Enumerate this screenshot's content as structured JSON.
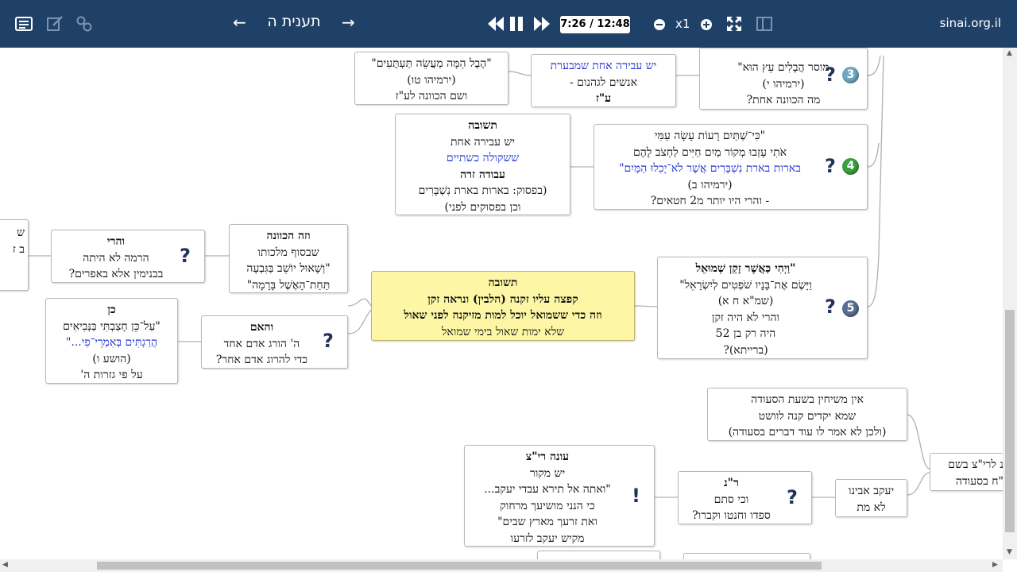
{
  "topbar": {
    "title": "תענית ה",
    "time": "7:26 / 12:48",
    "speed": "x1",
    "site": "sinai.org.il",
    "prev_arrow": "←",
    "next_arrow": "→",
    "icons": [
      "list-icon",
      "edit-icon",
      "link-icon",
      "rewind-icon",
      "pause-icon",
      "fast-forward-icon",
      "zoom-out-icon",
      "zoom-in-icon",
      "fullscreen-icon",
      "split-view-icon"
    ]
  },
  "colors": {
    "topbar": "#1f4168",
    "center_node": "#fdf7a5",
    "blue_text": "#1a2fd0",
    "num3": "#6fa8c2",
    "num4": "#3d9f43",
    "num5": "#5d6e96"
  },
  "mindmap": {
    "n_top_left": [
      "\"הֶבֶל הֵמָּה מַעֲשֵׂה תַּעְתֻּעִים\"",
      "(ירמיהו טו)",
      "ושם הכוונה לע\"ז"
    ],
    "n_top_mid": [
      "יש עבירה אחת  שמבערת",
      "אנשים לגהנום -",
      "ע\"ז"
    ],
    "n_q3": [
      "מוסר הֲבָלִים  עֵץ הוּא\"",
      "(ירמיהו י)",
      "מה הכוונה אחת?"
    ],
    "n_q3_num": "3",
    "n_answer1": [
      "תשובה",
      "יש עבירה אחת",
      "ששקולה כשתיים",
      "עבודה זרה",
      "(בפסוק: בארות בארת נִשְׁבָּרִים",
      "וכן בפסוקים לפני)"
    ],
    "n_q4": [
      "\"כִּי־שְׁתַּיִם רָעוֹת  עָשָׂה עַמִּי",
      "אֹתִי עָזְבוּ מְקוֹר מַיִם חַיִּים לַחְצֹב לָהֶם",
      "בארות בארת נִשְׁבָּרִים  אֲשֶׁר לֹא־יָכִלוּ הַמָּיִם\"",
      "(ירמיהו ב)",
      "- והרי היו יותר מ2 חטאים?"
    ],
    "n_q4_num": "4",
    "n_left_edge": [
      "ש",
      "",
      "ב ז"
    ],
    "n_vaharei": [
      "והרי",
      "הרמה לא היתה",
      "בבנימין אלא באפרים?"
    ],
    "n_hakavana": [
      "וזה הכוונה",
      "שבסוף מלכותו",
      "\"וְשָׁאוּל יוֹשֵׁב בַּגִּבְעָה",
      "תַּחַת־הָאֶשֶׁל בָּרָמָה\""
    ],
    "n_center": [
      "תשובה",
      "קפצה עליו זקנה  (הלבין) ונראה זקן",
      "וזה כדי ששמואל יוכל למות מזיקנה לפני שאול",
      "שלא ימות שאול בימי שמואל"
    ],
    "n_q5": [
      "\"וַיְהִי כַּאֲשֶׁר זָקֵן  שְׁמוּאֵל",
      "וַיָּשֶׂם אֶת־בָּנָיו שֹׁפְטִים לְיִשְׂרָאֵל\"",
      "(שמ\"א ח א)",
      "והרי לא היה זקן",
      "היה רק בן 52",
      "(ברייתא)?"
    ],
    "n_q5_num": "5",
    "n_ken": [
      "כן",
      "\"עַל־כֵּן חָצַבְתִּי בַּנְּבִיאִים",
      "הֲרַגְתִּים בְּאִמְרֵי־פִי...\"",
      "(הושע ו)",
      "על פי גזרות ה'"
    ],
    "n_vehaim": [
      "והאם",
      "ה' הורג אדם אחד",
      "כדי להרוג אדם אחר?"
    ],
    "n_seuda": [
      "אין משיחין בשעת הסעודה",
      "שמא יקדים קנה לוושט",
      "(ולכן לא אמר לו עוד דברים בסעודה)"
    ],
    "n_right_edge": [
      "נ לרי\"צ בשם",
      "\"ח בסעודה"
    ],
    "n_ona": [
      "עונה רי\"צ",
      "יש מקור",
      "\"ואתה אל תירא עבדי יעקב...",
      "כי הנני מושיעך מרחוק",
      "ואת זרעך מארץ שבים\"",
      "מקיש יעקב לזרעו"
    ],
    "n_rn": [
      "ר\"נ",
      "וכי סתם",
      "ספדו וחנטו וקברו?"
    ],
    "n_yaakov": [
      "יעקב אבינו",
      "לא מת"
    ]
  }
}
